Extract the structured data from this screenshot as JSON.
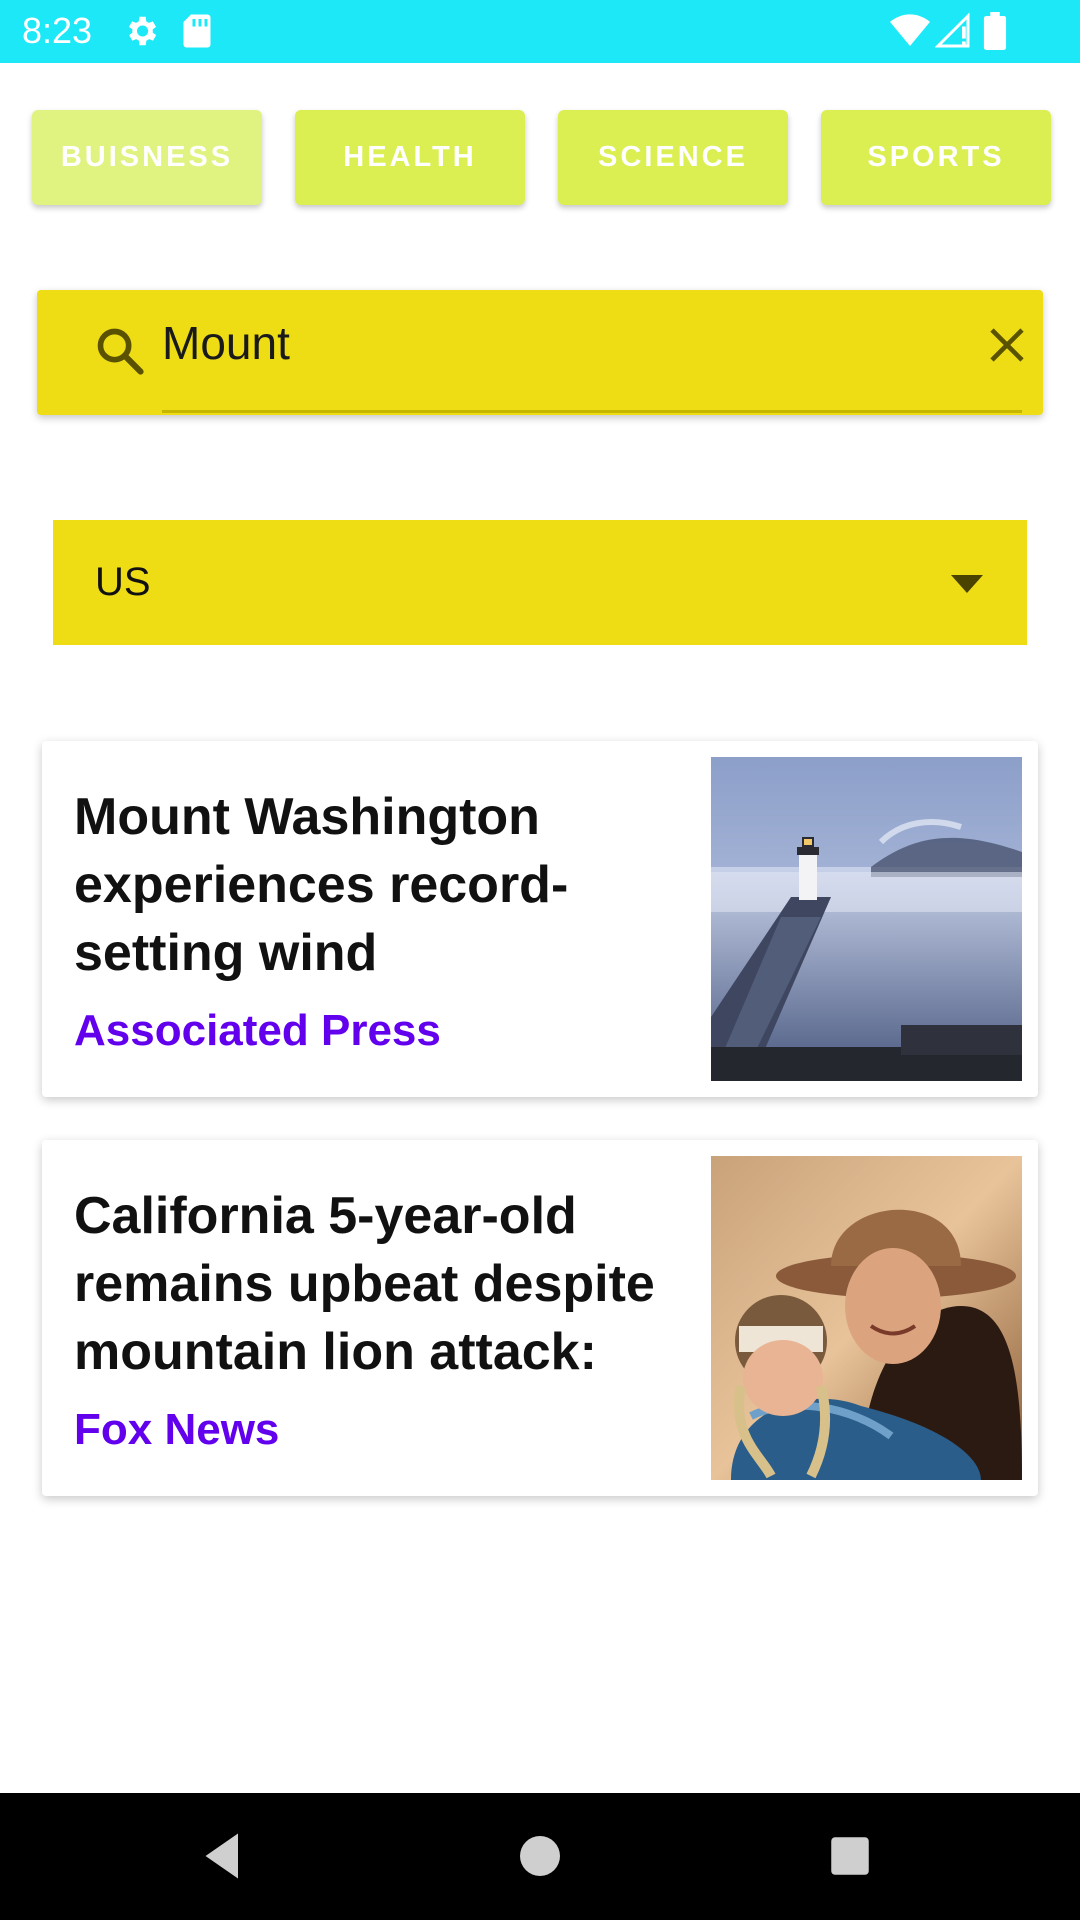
{
  "status_bar": {
    "time": "8:23",
    "icons": [
      "settings-icon",
      "sd-card-icon",
      "wifi-icon",
      "cell-signal-icon",
      "battery-icon"
    ]
  },
  "categories": [
    {
      "label": "BUISNESS"
    },
    {
      "label": "HEALTH"
    },
    {
      "label": "SCIENCE"
    },
    {
      "label": "SPORTS"
    }
  ],
  "search": {
    "value": "Mount",
    "icon": "search-icon",
    "clear_icon": "close-icon"
  },
  "country_select": {
    "value": "US",
    "icon": "dropdown-arrow-icon"
  },
  "articles": [
    {
      "title": "Mount Washington experiences record-setting wind",
      "source": "Associated Press",
      "image": "lighthouse-photo"
    },
    {
      "title": "California 5-year-old remains upbeat despite mountain lion attack:",
      "source": "Fox News",
      "image": "mother-child-photo"
    }
  ],
  "nav_bar": {
    "icons": [
      "back-icon",
      "home-icon",
      "recents-icon"
    ]
  },
  "colors": {
    "status_bar": "#1ce8f7",
    "category_button": "#dbef52",
    "search_bar": "#eedd14",
    "source_text": "#6200ee"
  }
}
